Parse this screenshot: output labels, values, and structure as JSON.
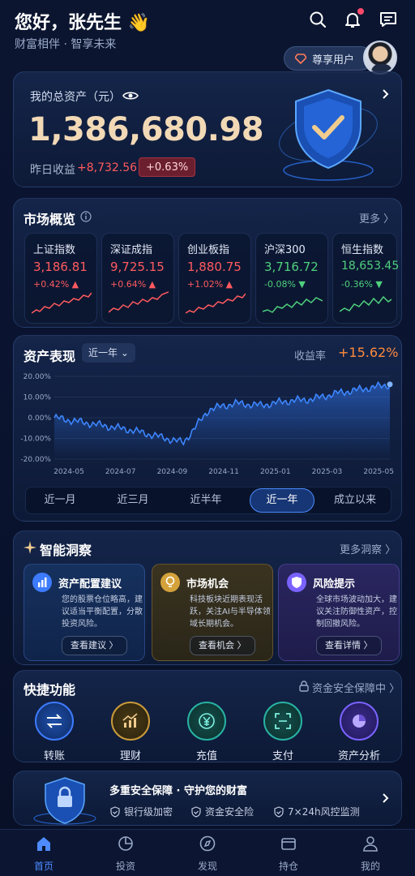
{
  "header": {
    "greeting": "您好，张先生 👋",
    "subtitle": "财富相伴 · 智享未来",
    "vip_label": "尊享用户"
  },
  "assets": {
    "label": "我的总资产（元）",
    "total": "1,386,680.98",
    "yesterday_label": "昨日收益",
    "yesterday_value": "+8,732.56",
    "yesterday_pct": "+0.63%"
  },
  "market": {
    "title": "市场概览",
    "more": "更多",
    "items": [
      {
        "name": "上证指数",
        "value": "3,186.81",
        "change": "+0.42% ▲",
        "trend": "up"
      },
      {
        "name": "深证成指",
        "value": "9,725.15",
        "change": "+0.64% ▲",
        "trend": "up"
      },
      {
        "name": "创业板指",
        "value": "1,880.75",
        "change": "+1.02% ▲",
        "trend": "up"
      },
      {
        "name": "沪深300",
        "value": "3,716.72",
        "change": "-0.08% ▼",
        "trend": "down"
      },
      {
        "name": "恒生指数",
        "value": "18,653.45",
        "change": "-0.36% ▼",
        "trend": "down"
      }
    ]
  },
  "performance": {
    "title": "资产表现",
    "period": "近一年",
    "rate_label": "收益率",
    "rate_value": "+15.62%",
    "tabs": [
      "近一月",
      "近三月",
      "近半年",
      "近一年",
      "成立以来"
    ],
    "active_tab": 3
  },
  "chart_data": {
    "type": "area",
    "title": "",
    "xlabel": "",
    "ylabel": "",
    "x": [
      "2024-05",
      "2024-06",
      "2024-07",
      "2024-08",
      "2024-09",
      "2024-10",
      "2024-11",
      "2024-12",
      "2025-01",
      "2025-02",
      "2025-03",
      "2025-04",
      "2025-05",
      "2025-06"
    ],
    "xticks": [
      "2024-05",
      "2024-07",
      "2024-09",
      "2024-11",
      "2025-01",
      "2025-03",
      "2025-05"
    ],
    "yticks": [
      "20.00%",
      "10.00%",
      "0.00%",
      "-10.00%",
      "-20.00%"
    ],
    "ylim": [
      -20,
      20
    ],
    "series": [
      {
        "values": [
          0,
          -2,
          -4,
          -6,
          -9,
          -12,
          4,
          7,
          6,
          8,
          9,
          12,
          14,
          16
        ]
      }
    ],
    "grid": true,
    "color": "#3d86ff"
  },
  "insights": {
    "title": "智能洞察",
    "more": "更多洞察",
    "cards": [
      {
        "title": "资产配置建议",
        "desc": "您的股票仓位略高，建议适当平衡配置，分散投资风险。",
        "button": "查看建议 〉",
        "color": "#3d7bff",
        "icon": "bar-chart-icon"
      },
      {
        "title": "市场机会",
        "desc": "科技板块近期表现活跃，关注AI与半导体领域长期机会。",
        "button": "查看机会 〉",
        "color": "#d4a23a",
        "icon": "lightbulb-icon"
      },
      {
        "title": "风险提示",
        "desc": "全球市场波动加大，建议关注防御性资产，控制回撤风险。",
        "button": "查看详情 〉",
        "color": "#7a62ff",
        "icon": "shield-icon"
      }
    ]
  },
  "quick": {
    "title": "快捷功能",
    "security": "资金安全保障中",
    "items": [
      {
        "label": "转账",
        "color": "#2e63d6",
        "icon": "transfer-icon"
      },
      {
        "label": "理财",
        "color": "#b8862e",
        "icon": "chart-icon"
      },
      {
        "label": "充值",
        "color": "#1f8f85",
        "icon": "yen-icon"
      },
      {
        "label": "支付",
        "color": "#1f8f85",
        "icon": "scan-icon"
      },
      {
        "label": "资产分析",
        "color": "#6b4fd6",
        "icon": "pie-icon"
      }
    ]
  },
  "security": {
    "title": "多重安全保障 · 守护您的财富",
    "features": [
      "银行级加密",
      "资金安全险",
      "7×24h风控监测"
    ]
  },
  "nav": {
    "items": [
      "首页",
      "投资",
      "发现",
      "持仓",
      "我的"
    ],
    "active": 0
  }
}
